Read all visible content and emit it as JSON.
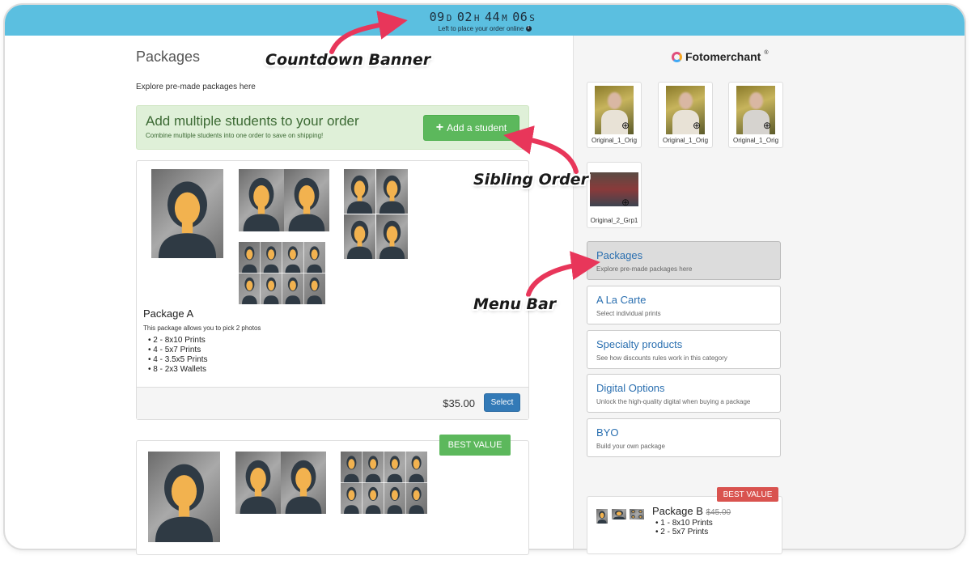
{
  "banner": {
    "days": "09",
    "days_unit": "D",
    "hours": "02",
    "hours_unit": "H",
    "minutes": "44",
    "minutes_unit": "M",
    "seconds": "06",
    "seconds_unit": "S",
    "subtitle": "Left to place your order online",
    "info_icon": "i",
    "color": "#5bbfe0"
  },
  "main": {
    "title": "Packages",
    "description": "Explore pre-made packages here"
  },
  "sibling": {
    "title": "Add multiple students to your order",
    "subtitle": "Combine multiple students into one order to save on shipping!",
    "button_label": "Add a student",
    "button_icon": "plus-icon"
  },
  "package_a": {
    "name": "Package A",
    "description": "This package allows you to pick 2 photos",
    "items": [
      "2 - 8x10 Prints",
      "4 - 5x7 Prints",
      "4 - 3.5x5 Prints",
      "8 - 2x3 Wallets"
    ],
    "price": "$35.00",
    "select_label": "Select"
  },
  "package_2": {
    "badge": "BEST VALUE"
  },
  "brand": {
    "name": "Fotomerchant",
    "trademark": "®"
  },
  "thumbnails": [
    {
      "caption": "Original_1_Orig"
    },
    {
      "caption": "Original_1_Orig"
    },
    {
      "caption": "Original_1_Orig"
    },
    {
      "caption": "Original_2_Grp1"
    }
  ],
  "menu": [
    {
      "title": "Packages",
      "subtitle": "Explore pre-made packages here",
      "active": true
    },
    {
      "title": "A La Carte",
      "subtitle": "Select individual prints"
    },
    {
      "title": "Specialty products",
      "subtitle": "See how discounts rules work in this category"
    },
    {
      "title": "Digital Options",
      "subtitle": "Unlock the high-quality digital when buying a package"
    },
    {
      "title": "BYO",
      "subtitle": "Build your own package"
    }
  ],
  "side_package": {
    "badge": "BEST VALUE",
    "name": "Package B",
    "old_price": "$45.00",
    "items": [
      "1 - 8x10 Prints",
      "2 - 5x7 Prints"
    ]
  },
  "annotations": {
    "countdown": "Countdown Banner",
    "sibling": "Sibling Order",
    "menu": "Menu Bar",
    "arrow_color": "#e8365a"
  },
  "colors": {
    "accent_blue": "#337ab7",
    "success_green": "#5cb85c",
    "danger_red": "#d9534f"
  }
}
